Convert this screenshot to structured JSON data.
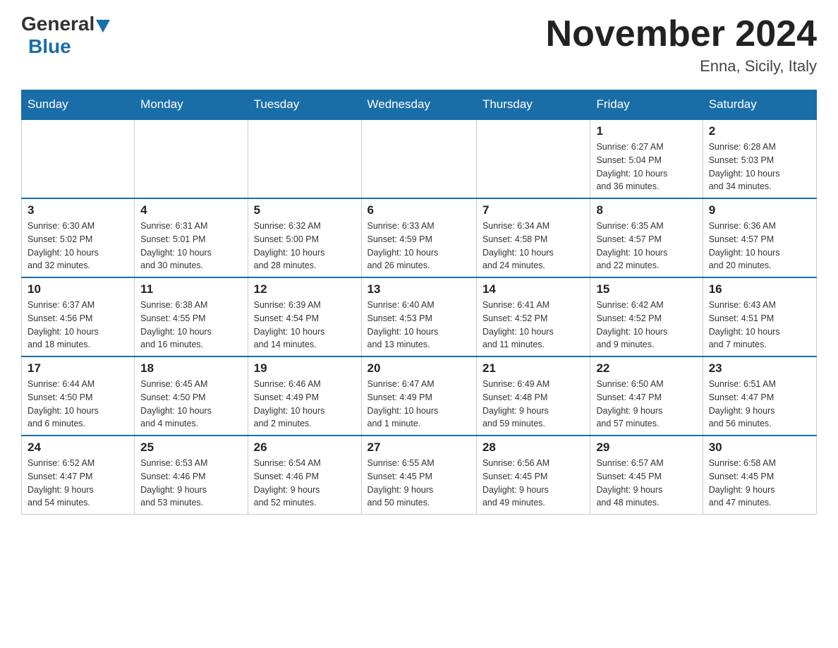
{
  "header": {
    "logo_general": "General",
    "logo_blue": "Blue",
    "month_title": "November 2024",
    "location": "Enna, Sicily, Italy"
  },
  "days_of_week": [
    "Sunday",
    "Monday",
    "Tuesday",
    "Wednesday",
    "Thursday",
    "Friday",
    "Saturday"
  ],
  "weeks": [
    [
      {
        "day": "",
        "info": ""
      },
      {
        "day": "",
        "info": ""
      },
      {
        "day": "",
        "info": ""
      },
      {
        "day": "",
        "info": ""
      },
      {
        "day": "",
        "info": ""
      },
      {
        "day": "1",
        "info": "Sunrise: 6:27 AM\nSunset: 5:04 PM\nDaylight: 10 hours\nand 36 minutes."
      },
      {
        "day": "2",
        "info": "Sunrise: 6:28 AM\nSunset: 5:03 PM\nDaylight: 10 hours\nand 34 minutes."
      }
    ],
    [
      {
        "day": "3",
        "info": "Sunrise: 6:30 AM\nSunset: 5:02 PM\nDaylight: 10 hours\nand 32 minutes."
      },
      {
        "day": "4",
        "info": "Sunrise: 6:31 AM\nSunset: 5:01 PM\nDaylight: 10 hours\nand 30 minutes."
      },
      {
        "day": "5",
        "info": "Sunrise: 6:32 AM\nSunset: 5:00 PM\nDaylight: 10 hours\nand 28 minutes."
      },
      {
        "day": "6",
        "info": "Sunrise: 6:33 AM\nSunset: 4:59 PM\nDaylight: 10 hours\nand 26 minutes."
      },
      {
        "day": "7",
        "info": "Sunrise: 6:34 AM\nSunset: 4:58 PM\nDaylight: 10 hours\nand 24 minutes."
      },
      {
        "day": "8",
        "info": "Sunrise: 6:35 AM\nSunset: 4:57 PM\nDaylight: 10 hours\nand 22 minutes."
      },
      {
        "day": "9",
        "info": "Sunrise: 6:36 AM\nSunset: 4:57 PM\nDaylight: 10 hours\nand 20 minutes."
      }
    ],
    [
      {
        "day": "10",
        "info": "Sunrise: 6:37 AM\nSunset: 4:56 PM\nDaylight: 10 hours\nand 18 minutes."
      },
      {
        "day": "11",
        "info": "Sunrise: 6:38 AM\nSunset: 4:55 PM\nDaylight: 10 hours\nand 16 minutes."
      },
      {
        "day": "12",
        "info": "Sunrise: 6:39 AM\nSunset: 4:54 PM\nDaylight: 10 hours\nand 14 minutes."
      },
      {
        "day": "13",
        "info": "Sunrise: 6:40 AM\nSunset: 4:53 PM\nDaylight: 10 hours\nand 13 minutes."
      },
      {
        "day": "14",
        "info": "Sunrise: 6:41 AM\nSunset: 4:52 PM\nDaylight: 10 hours\nand 11 minutes."
      },
      {
        "day": "15",
        "info": "Sunrise: 6:42 AM\nSunset: 4:52 PM\nDaylight: 10 hours\nand 9 minutes."
      },
      {
        "day": "16",
        "info": "Sunrise: 6:43 AM\nSunset: 4:51 PM\nDaylight: 10 hours\nand 7 minutes."
      }
    ],
    [
      {
        "day": "17",
        "info": "Sunrise: 6:44 AM\nSunset: 4:50 PM\nDaylight: 10 hours\nand 6 minutes."
      },
      {
        "day": "18",
        "info": "Sunrise: 6:45 AM\nSunset: 4:50 PM\nDaylight: 10 hours\nand 4 minutes."
      },
      {
        "day": "19",
        "info": "Sunrise: 6:46 AM\nSunset: 4:49 PM\nDaylight: 10 hours\nand 2 minutes."
      },
      {
        "day": "20",
        "info": "Sunrise: 6:47 AM\nSunset: 4:49 PM\nDaylight: 10 hours\nand 1 minute."
      },
      {
        "day": "21",
        "info": "Sunrise: 6:49 AM\nSunset: 4:48 PM\nDaylight: 9 hours\nand 59 minutes."
      },
      {
        "day": "22",
        "info": "Sunrise: 6:50 AM\nSunset: 4:47 PM\nDaylight: 9 hours\nand 57 minutes."
      },
      {
        "day": "23",
        "info": "Sunrise: 6:51 AM\nSunset: 4:47 PM\nDaylight: 9 hours\nand 56 minutes."
      }
    ],
    [
      {
        "day": "24",
        "info": "Sunrise: 6:52 AM\nSunset: 4:47 PM\nDaylight: 9 hours\nand 54 minutes."
      },
      {
        "day": "25",
        "info": "Sunrise: 6:53 AM\nSunset: 4:46 PM\nDaylight: 9 hours\nand 53 minutes."
      },
      {
        "day": "26",
        "info": "Sunrise: 6:54 AM\nSunset: 4:46 PM\nDaylight: 9 hours\nand 52 minutes."
      },
      {
        "day": "27",
        "info": "Sunrise: 6:55 AM\nSunset: 4:45 PM\nDaylight: 9 hours\nand 50 minutes."
      },
      {
        "day": "28",
        "info": "Sunrise: 6:56 AM\nSunset: 4:45 PM\nDaylight: 9 hours\nand 49 minutes."
      },
      {
        "day": "29",
        "info": "Sunrise: 6:57 AM\nSunset: 4:45 PM\nDaylight: 9 hours\nand 48 minutes."
      },
      {
        "day": "30",
        "info": "Sunrise: 6:58 AM\nSunset: 4:45 PM\nDaylight: 9 hours\nand 47 minutes."
      }
    ]
  ]
}
